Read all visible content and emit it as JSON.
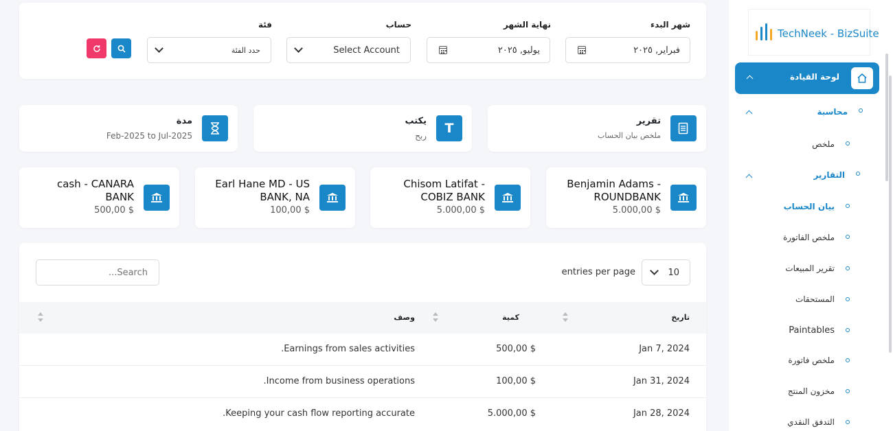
{
  "filters": {
    "start_month_label": "شهر البدء",
    "start_month_value": "فبراير, ٢٠٢٥",
    "end_month_label": "نهاية الشهر",
    "end_month_value": "يوليو, ٢٠٢٥",
    "account_label": "حساب",
    "account_value": "Select Account",
    "category_label": "فئة",
    "category_value": "حدد الفئة"
  },
  "info_cards": {
    "report_title": "تقرير",
    "report_sub": "ملخص بيان الحساب",
    "type_title": "يكتب",
    "type_sub": "ربح",
    "period_title": "مدة",
    "period_sub": "Feb-2025 to Jul-2025"
  },
  "accounts": [
    {
      "name": "Benjamin Adams - ROUNDBANK",
      "amount": "5.000,00 $"
    },
    {
      "name": "Chisom Latifat - COBIZ BANK",
      "amount": "5.000,00 $"
    },
    {
      "name": "Earl Hane MD - US BANK, NA",
      "amount": "100,00 $"
    },
    {
      "name": "cash - CANARA BANK",
      "amount": "500,00 $"
    }
  ],
  "table": {
    "entries_value": "10",
    "entries_label": "entries per page",
    "search_placeholder": "...Search",
    "columns": {
      "date": "تاريخ",
      "amount": "كمية",
      "description": "وصف"
    },
    "rows": [
      {
        "date": "Jan 7, 2024",
        "amount": "500,00 $",
        "description": ".Earnings from sales activities"
      },
      {
        "date": "Jan 31, 2024",
        "amount": "100,00 $",
        "description": ".Income from business operations"
      },
      {
        "date": "Jan 28, 2024",
        "amount": "5.000,00 $",
        "description": ".Keeping your cash flow reporting accurate"
      }
    ]
  },
  "sidebar": {
    "brand": "TechNeek - BizSuite",
    "dashboard": "لوحة القيادة",
    "accounting": "محاسبة",
    "summary": "ملخص",
    "reports": "التقارير",
    "account_statement": "بيان الحساب",
    "invoice_summary": "ملخص الفاتورة",
    "sales_report": "تقرير المبيعات",
    "receivables": "المستحقات",
    "paintables": "Paintables",
    "bill_summary": "ملخص فاتورة",
    "product_stock": "مخزون المنتج",
    "cash_flow": "التدفق النقدي"
  },
  "colors": {
    "primary": "#1a87c9",
    "refresh": "#f0386b"
  },
  "icons": {
    "calendar": "calendar-icon",
    "chevron": "chevron-down-icon",
    "search": "search-icon",
    "refresh": "refresh-icon",
    "report": "document-icon",
    "type": "text-icon",
    "period": "hourglass-icon",
    "bank": "bank-icon",
    "home": "home-icon"
  }
}
